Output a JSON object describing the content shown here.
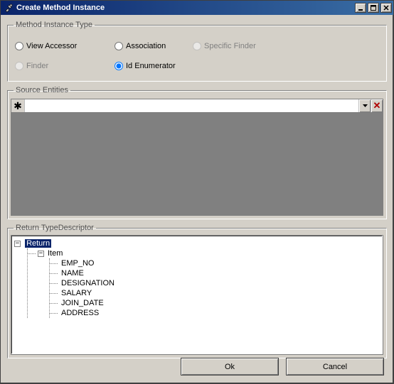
{
  "title": "Create Method Instance",
  "groups": {
    "method_type": {
      "legend": "Method Instance Type",
      "radios": {
        "view_accessor": "View Accessor",
        "association": "Association",
        "specific_finder": "Specific Finder",
        "finder": "Finder",
        "id_enumerator": "Id Enumerator"
      },
      "states": {
        "view_accessor_enabled": true,
        "association_enabled": true,
        "specific_finder_enabled": false,
        "finder_enabled": false,
        "id_enumerator_enabled": true,
        "selected": "id_enumerator"
      }
    },
    "source_entities": {
      "legend": "Source Entities",
      "new_row_marker": "✱",
      "value": "",
      "close_label": "✕"
    },
    "return_type": {
      "legend": "Return TypeDescriptor",
      "root": "Return",
      "item_label": "Item",
      "fields": [
        "EMP_NO",
        "NAME",
        "DESIGNATION",
        "SALARY",
        "JOIN_DATE",
        "ADDRESS"
      ]
    }
  },
  "buttons": {
    "ok": "Ok",
    "cancel": "Cancel"
  },
  "title_controls": {
    "minimize": "_",
    "maximize": "□",
    "close": "✕"
  }
}
